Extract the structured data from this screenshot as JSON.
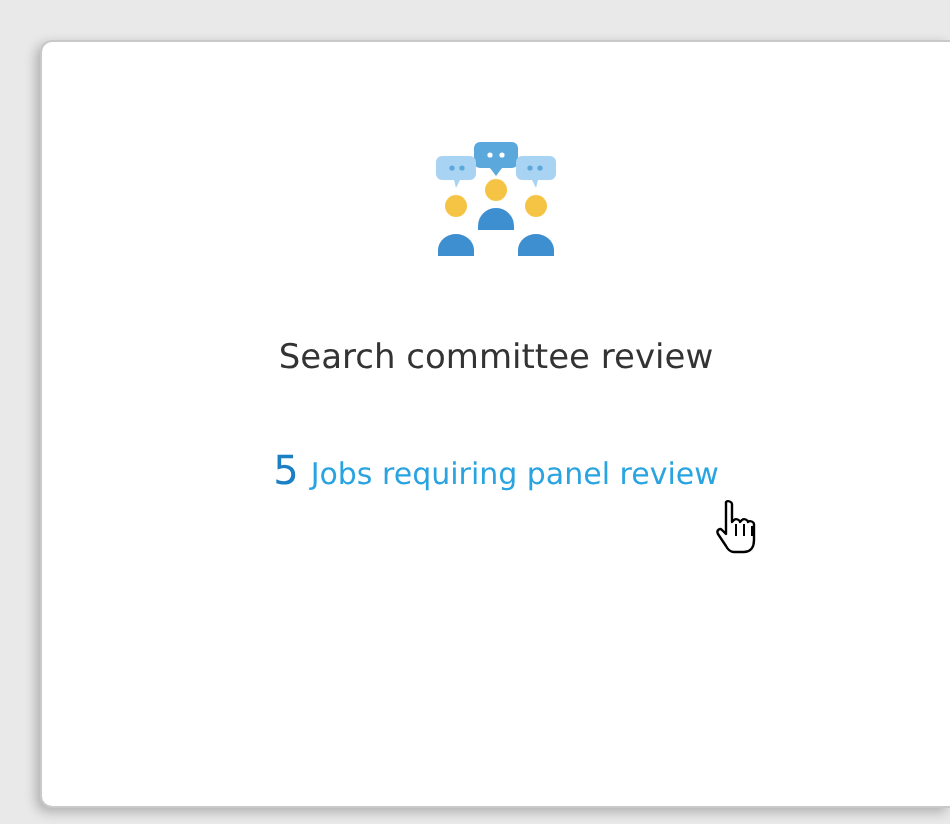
{
  "card": {
    "title": "Search committee review",
    "link": {
      "count": "5",
      "label": "Jobs requiring panel review"
    }
  }
}
